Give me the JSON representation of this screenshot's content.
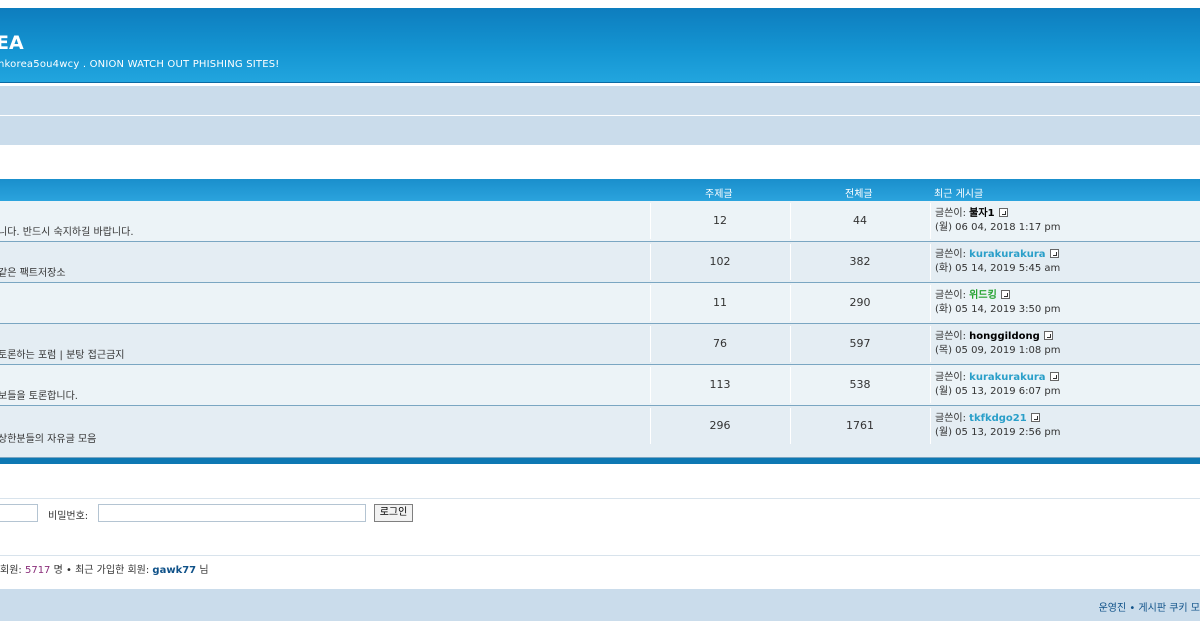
{
  "header": {
    "title": "EA",
    "description": "nkorea5ou4wcy . ONION WATCH OUT PHISHING SITES!"
  },
  "table": {
    "headers": {
      "topics": "주제글",
      "posts": "전체글",
      "last_post": "최근 게시글"
    },
    "rows": [
      {
        "desc": "니다. 반드시 숙지하길 바랍니다.",
        "topics": "12",
        "posts": "44",
        "by_label": "글쓴이:",
        "author": "불자1",
        "author_color": "#000000",
        "date": "(월) 06 04, 2018 1:17 pm"
      },
      {
        "desc": "같은 팩트저장소",
        "topics": "102",
        "posts": "382",
        "by_label": "글쓴이:",
        "author": "kurakurakura",
        "author_color": "#2a9fc9",
        "date": "(화) 05 14, 2019 5:45 am"
      },
      {
        "desc": "",
        "topics": "11",
        "posts": "290",
        "by_label": "글쓴이:",
        "author": "위드킹",
        "author_color": "#26a332",
        "date": "(화) 05 14, 2019 3:50 pm"
      },
      {
        "desc": "토론하는 포럼 | 분탕 접근금지",
        "topics": "76",
        "posts": "597",
        "by_label": "글쓴이:",
        "author": "honggildong",
        "author_color": "#000000",
        "date": "(목) 05 09, 2019 1:08 pm"
      },
      {
        "desc": "보들을 토론합니다.",
        "topics": "113",
        "posts": "538",
        "by_label": "글쓴이:",
        "author": "kurakurakura",
        "author_color": "#2a9fc9",
        "date": "(월) 05 13, 2019 6:07 pm"
      },
      {
        "desc": "상한분들의 자유글 모음",
        "topics": "296",
        "posts": "1761",
        "by_label": "글쓴이:",
        "author": "tkfkdgo21",
        "author_color": "#2a9fc9",
        "date": "(월) 05 13, 2019 2:56 pm"
      }
    ]
  },
  "login": {
    "password_label": "비밀번호:",
    "button_label": "로그인"
  },
  "stats": {
    "members_label": "회원:",
    "members_count": "5717",
    "members_unit": "명",
    "separator": "•",
    "newest_label": "최근 가입한 회원:",
    "newest_member": "gawk77",
    "newest_suffix": "님"
  },
  "footer": {
    "links": "운영진 • 게시판 쿠키 모"
  },
  "colors": {
    "header_blue": "#1596d3",
    "nav_bar": "#cadceb",
    "table_foot": "#0e78b3"
  }
}
